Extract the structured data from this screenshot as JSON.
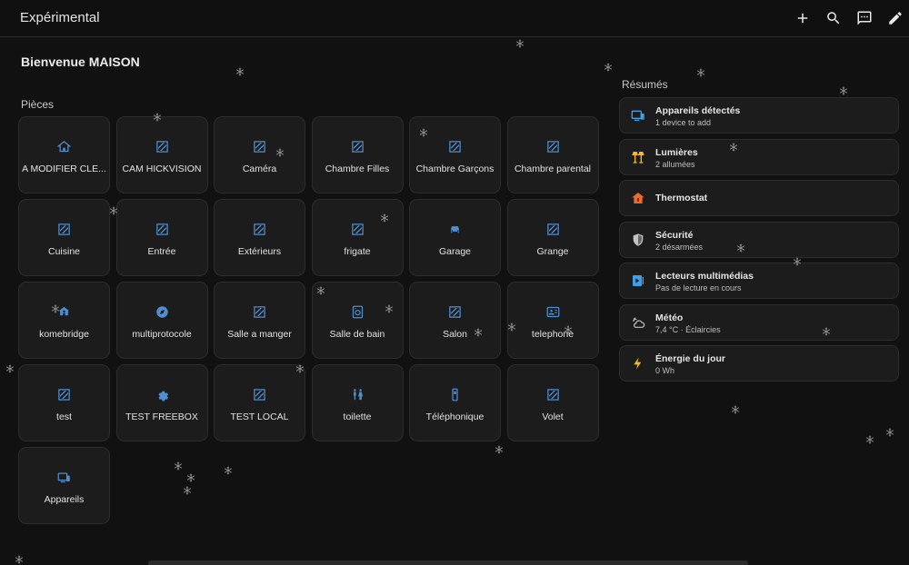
{
  "header": {
    "title": "Expérimental",
    "actions": [
      {
        "name": "add",
        "icon": "plus-icon"
      },
      {
        "name": "search",
        "icon": "search-icon"
      },
      {
        "name": "assist",
        "icon": "chat-icon"
      },
      {
        "name": "edit",
        "icon": "pencil-icon"
      }
    ]
  },
  "welcome": "Bienvenue MAISON",
  "rooms_section": {
    "title": "Pièces",
    "rooms": [
      {
        "label": "A MODIFIER CLE...",
        "icon": "home-icon",
        "color": "#4f8fd0"
      },
      {
        "label": "CAM HICKVISION",
        "icon": "area-icon",
        "color": "#4f8fd0"
      },
      {
        "label": "Caméra",
        "icon": "area-icon",
        "color": "#4f8fd0"
      },
      {
        "label": "Chambre Filles",
        "icon": "area-icon",
        "color": "#4f8fd0"
      },
      {
        "label": "Chambre Garçons",
        "icon": "area-icon",
        "color": "#4f8fd0"
      },
      {
        "label": "Chambre parental",
        "icon": "area-icon",
        "color": "#4f8fd0"
      },
      {
        "label": "Cuisine",
        "icon": "area-icon",
        "color": "#4f8fd0"
      },
      {
        "label": "Entrée",
        "icon": "area-icon",
        "color": "#4f8fd0"
      },
      {
        "label": "Extérieurs",
        "icon": "area-icon",
        "color": "#4f8fd0"
      },
      {
        "label": "frigate",
        "icon": "area-icon",
        "color": "#4f8fd0"
      },
      {
        "label": "Garage",
        "icon": "car-icon",
        "color": "#4f8fd0"
      },
      {
        "label": "Grange",
        "icon": "area-icon",
        "color": "#4f8fd0"
      },
      {
        "label": "komebridge",
        "icon": "home-network-icon",
        "color": "#4f8fd0"
      },
      {
        "label": "multiprotocole",
        "icon": "compass-icon",
        "color": "#4f8fd0"
      },
      {
        "label": "Salle a manger",
        "icon": "area-icon",
        "color": "#4f8fd0"
      },
      {
        "label": "Salle de bain",
        "icon": "washer-icon",
        "color": "#4f8fd0"
      },
      {
        "label": "Salon",
        "icon": "area-icon",
        "color": "#4f8fd0"
      },
      {
        "label": "telephone",
        "icon": "contact-card-icon",
        "color": "#4f8fd0"
      },
      {
        "label": "test",
        "icon": "area-icon",
        "color": "#4f8fd0"
      },
      {
        "label": "TEST FREEBOX",
        "icon": "gear-icon",
        "color": "#4f8fd0"
      },
      {
        "label": "TEST LOCAL",
        "icon": "area-icon",
        "color": "#4f8fd0"
      },
      {
        "label": "toilette",
        "icon": "restroom-icon",
        "color": "#4f8fd0"
      },
      {
        "label": "Téléphonique",
        "icon": "phone-icon",
        "color": "#4f8fd0"
      },
      {
        "label": "Volet",
        "icon": "area-icon",
        "color": "#4f8fd0"
      },
      {
        "label": "Appareils",
        "icon": "devices-icon",
        "color": "#4f8fd0"
      }
    ]
  },
  "summaries_section": {
    "title": "Résumés",
    "items": [
      {
        "title": "Appareils détectés",
        "subtitle": "1 device to add",
        "icon": "devices-icon",
        "color": "#3ea0e8"
      },
      {
        "title": "Lumières",
        "subtitle": "2 allumées",
        "icon": "lamps-icon",
        "color": "#f5b82e"
      },
      {
        "title": "Thermostat",
        "subtitle": "",
        "icon": "home-thermostat-icon",
        "color": "#f06a2c"
      },
      {
        "title": "Sécurité",
        "subtitle": "2 désarmées",
        "icon": "shield-icon",
        "color": "#bfc3c7"
      },
      {
        "title": "Lecteurs multimédias",
        "subtitle": "Pas de lecture en cours",
        "icon": "media-icon",
        "color": "#3ea0e8"
      },
      {
        "title": "Météo",
        "subtitle": "7,4 °C · Éclaircies",
        "icon": "weather-partly-cloudy-icon",
        "color": "#bfc3c7"
      },
      {
        "title": "Énergie du jour",
        "subtitle": "0 Wh",
        "icon": "lightning-icon",
        "color": "#f5b82e"
      }
    ]
  },
  "colors": {
    "background": "#111111",
    "card": "#1c1c1c",
    "accent": "#4f8fd0",
    "snowflake": "#9a9a9a"
  }
}
